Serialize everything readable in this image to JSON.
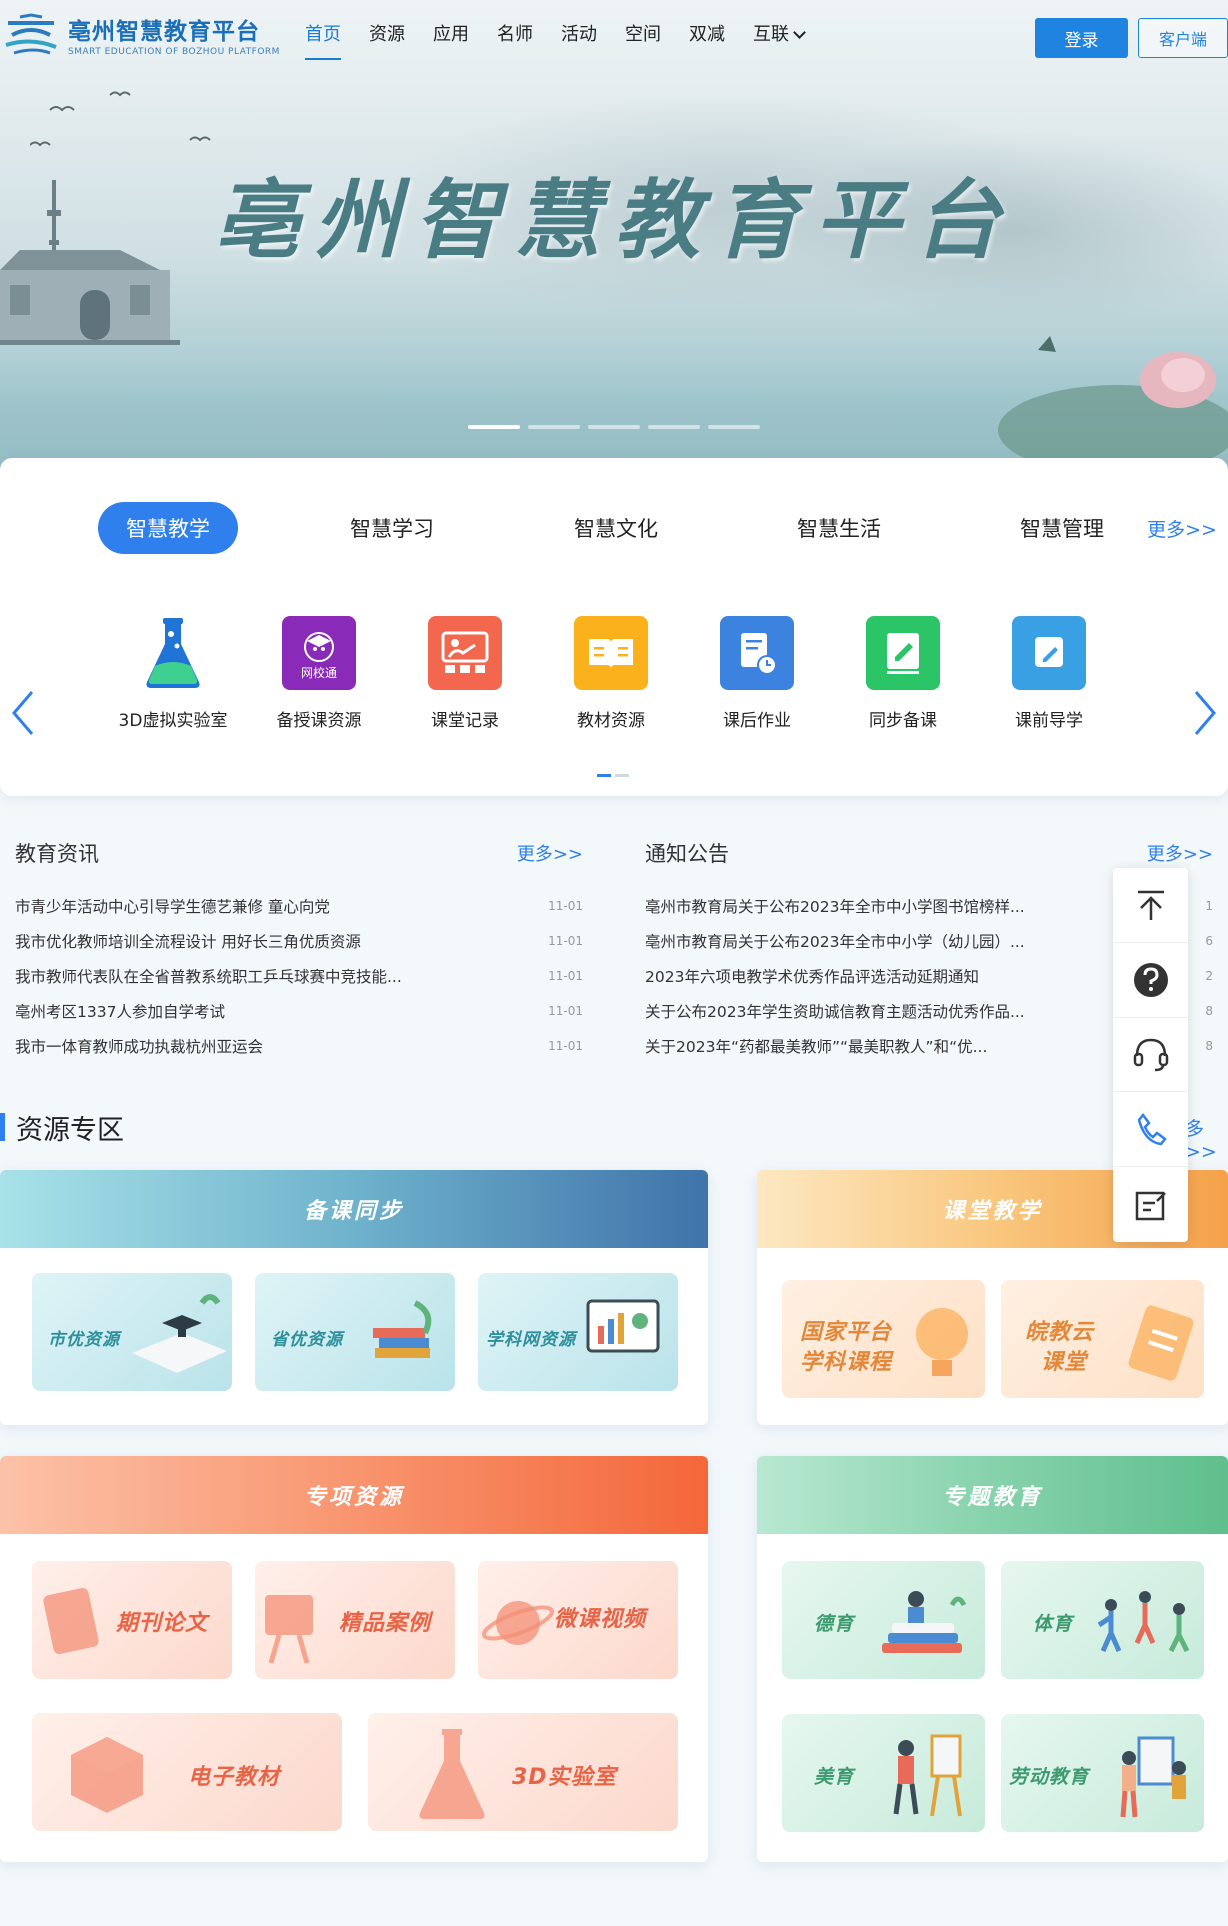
{
  "header": {
    "logo_title": "亳州智慧教育平台",
    "logo_sub": "SMART EDUCATION OF BOZHOU PLATFORM",
    "nav": [
      "首页",
      "资源",
      "应用",
      "名师",
      "活动",
      "空间",
      "双减",
      "互联"
    ],
    "login": "登录",
    "client": "客户端"
  },
  "hero": {
    "title": "亳州智慧教育平台"
  },
  "categories": {
    "tabs": [
      "智慧教学",
      "智慧学习",
      "智慧文化",
      "智慧生活",
      "智慧管理"
    ],
    "more": "更多>>",
    "apps": [
      {
        "label": "3D虚拟实验室",
        "icon": "flask-icon"
      },
      {
        "label": "备授课资源",
        "icon": "wangxiaotong-icon",
        "badge": "网校通"
      },
      {
        "label": "课堂记录",
        "icon": "classroom-icon"
      },
      {
        "label": "教材资源",
        "icon": "book-icon"
      },
      {
        "label": "课后作业",
        "icon": "homework-icon"
      },
      {
        "label": "同步备课",
        "icon": "lesson-prep-icon"
      },
      {
        "label": "课前导学",
        "icon": "guide-icon"
      }
    ]
  },
  "news": {
    "title": "教育资讯",
    "more": "更多>>",
    "items": [
      {
        "text": "市青少年活动中心引导学生德艺兼修 童心向党",
        "date": "11-01"
      },
      {
        "text": "我市优化教师培训全流程设计 用好长三角优质资源",
        "date": "11-01"
      },
      {
        "text": "我市教师代表队在全省普教系统职工乒乓球赛中竞技能...",
        "date": "11-01"
      },
      {
        "text": "亳州考区1337人参加自学考试",
        "date": "11-01"
      },
      {
        "text": "我市一体育教师成功执裁杭州亚运会",
        "date": "11-01"
      }
    ]
  },
  "notices": {
    "title": "通知公告",
    "more": "更多>>",
    "items": [
      {
        "text": "亳州市教育局关于公布2023年全市中小学图书馆榜样...",
        "date": "1"
      },
      {
        "text": "亳州市教育局关于公布2023年全市中小学（幼儿园）...",
        "date": "6"
      },
      {
        "text": "2023年六项电教学术优秀作品评选活动延期通知",
        "date": "2"
      },
      {
        "text": "关于公布2023年学生资助诚信教育主题活动优秀作品...",
        "date": "8"
      },
      {
        "text": "关于2023年“药都最美教师”“最美职教人”和“优...",
        "date": "8"
      }
    ]
  },
  "resources": {
    "title": "资源专区",
    "more": "多>>",
    "panels": {
      "beike": {
        "title": "备课同步",
        "tiles": [
          "市优资源",
          "省优资源",
          "学科网资源"
        ]
      },
      "ketang": {
        "title": "课堂教学",
        "tiles": [
          [
            "国家平台",
            "学科课程"
          ],
          [
            "皖教云",
            "课堂"
          ]
        ]
      },
      "zhuanxiang": {
        "title": "专项资源",
        "tiles": [
          "期刊论文",
          "精品案例",
          "微课视频",
          "电子教材",
          "3D实验室"
        ]
      },
      "zhuanti": {
        "title": "专题教育",
        "tiles": [
          "德育",
          "体育",
          "美育",
          "劳动教育"
        ]
      }
    }
  },
  "colors": {
    "primary": "#2f80ed",
    "nav_active": "#1a7ad6"
  }
}
